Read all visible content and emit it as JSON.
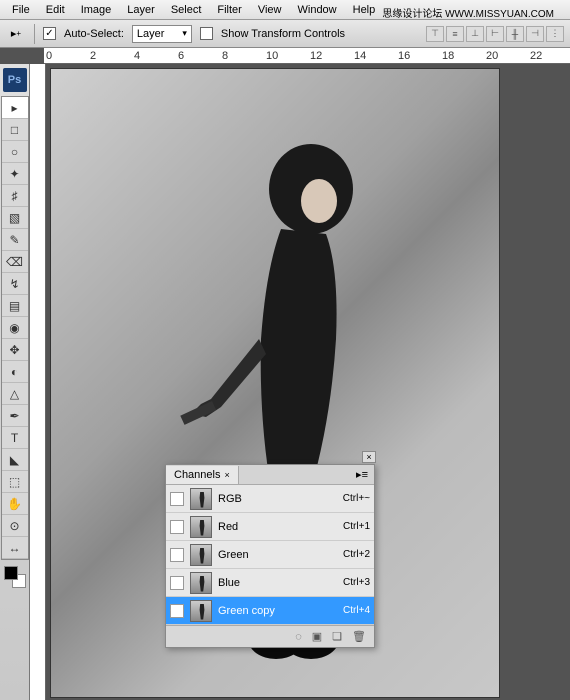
{
  "menu": {
    "items": [
      "File",
      "Edit",
      "Image",
      "Layer",
      "Select",
      "Filter",
      "View",
      "Window",
      "Help"
    ]
  },
  "watermark": "思缘设计论坛 WWW.MISSYUAN.COM",
  "options": {
    "auto_select_label": "Auto-Select:",
    "auto_select_value": "Layer",
    "show_transform_label": "Show Transform Controls"
  },
  "ruler_ticks": [
    "0",
    "2",
    "4",
    "6",
    "8",
    "10",
    "12",
    "14",
    "16",
    "18",
    "20",
    "22"
  ],
  "panel": {
    "title": "Channels",
    "rows": [
      {
        "name": "RGB",
        "shortcut": "Ctrl+~",
        "visible": false,
        "selected": false
      },
      {
        "name": "Red",
        "shortcut": "Ctrl+1",
        "visible": false,
        "selected": false
      },
      {
        "name": "Green",
        "shortcut": "Ctrl+2",
        "visible": false,
        "selected": false
      },
      {
        "name": "Blue",
        "shortcut": "Ctrl+3",
        "visible": false,
        "selected": false
      },
      {
        "name": "Green copy",
        "shortcut": "Ctrl+4",
        "visible": true,
        "selected": true
      }
    ]
  },
  "tools": [
    "▸",
    "□",
    "○",
    "✦",
    "♯",
    "▧",
    "✎",
    "⌫",
    "↯",
    "▤",
    "◉",
    "✥",
    "◐",
    "△",
    "✒",
    "T",
    "◣",
    "⬚",
    "✋",
    "⊙",
    "↔"
  ]
}
